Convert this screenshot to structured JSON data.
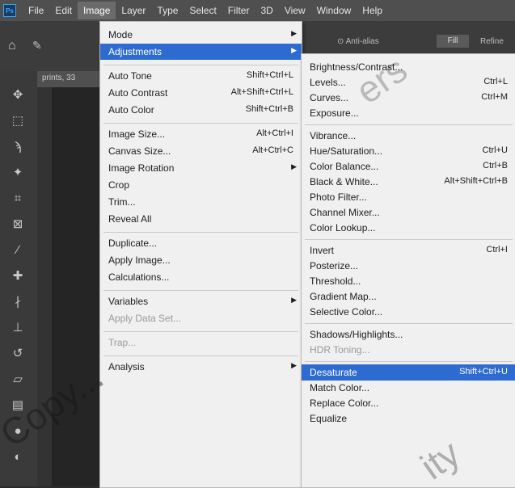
{
  "menubar": {
    "logo": "Ps",
    "items": [
      "File",
      "Edit",
      "Image",
      "Layer",
      "Type",
      "Select",
      "Filter",
      "3D",
      "View",
      "Window",
      "Help"
    ],
    "active": "Image"
  },
  "document": {
    "tab_label": "prints, 33"
  },
  "options_bar": {
    "label_left": "⊙ Anti-alias",
    "button": "Fill",
    "label_right": "Refine"
  },
  "toolbar": {
    "tools": [
      "move-icon",
      "marquee-icon",
      "lasso-icon",
      "magic-wand-icon",
      "crop-icon",
      "frame-icon",
      "eyedropper-icon",
      "healing-icon",
      "brush-icon",
      "stamp-icon",
      "history-brush-icon",
      "eraser-icon",
      "gradient-icon",
      "blur-icon",
      "dodge-icon"
    ]
  },
  "image_menu": {
    "items": [
      {
        "label": "Mode",
        "shortcut": "",
        "submenu": true
      },
      {
        "label": "Adjustments",
        "shortcut": "",
        "submenu": true,
        "highlighted": true
      },
      {
        "separator": true
      },
      {
        "label": "Auto Tone",
        "shortcut": "Shift+Ctrl+L"
      },
      {
        "label": "Auto Contrast",
        "shortcut": "Alt+Shift+Ctrl+L"
      },
      {
        "label": "Auto Color",
        "shortcut": "Shift+Ctrl+B"
      },
      {
        "separator": true
      },
      {
        "label": "Image Size...",
        "shortcut": "Alt+Ctrl+I"
      },
      {
        "label": "Canvas Size...",
        "shortcut": "Alt+Ctrl+C"
      },
      {
        "label": "Image Rotation",
        "shortcut": "",
        "submenu": true
      },
      {
        "label": "Crop",
        "shortcut": ""
      },
      {
        "label": "Trim...",
        "shortcut": ""
      },
      {
        "label": "Reveal All",
        "shortcut": ""
      },
      {
        "separator": true
      },
      {
        "label": "Duplicate...",
        "shortcut": ""
      },
      {
        "label": "Apply Image...",
        "shortcut": ""
      },
      {
        "label": "Calculations...",
        "shortcut": ""
      },
      {
        "separator": true
      },
      {
        "label": "Variables",
        "shortcut": "",
        "submenu": true
      },
      {
        "label": "Apply Data Set...",
        "shortcut": "",
        "disabled": true
      },
      {
        "separator": true
      },
      {
        "label": "Trap...",
        "shortcut": "",
        "disabled": true
      },
      {
        "separator": true
      },
      {
        "label": "Analysis",
        "shortcut": "",
        "submenu": true
      }
    ]
  },
  "adjustments_menu": {
    "items": [
      {
        "label": "Brightness/Contrast...",
        "shortcut": ""
      },
      {
        "label": "Levels...",
        "shortcut": "Ctrl+L"
      },
      {
        "label": "Curves...",
        "shortcut": "Ctrl+M"
      },
      {
        "label": "Exposure...",
        "shortcut": ""
      },
      {
        "separator": true
      },
      {
        "label": "Vibrance...",
        "shortcut": ""
      },
      {
        "label": "Hue/Saturation...",
        "shortcut": "Ctrl+U"
      },
      {
        "label": "Color Balance...",
        "shortcut": "Ctrl+B"
      },
      {
        "label": "Black & White...",
        "shortcut": "Alt+Shift+Ctrl+B"
      },
      {
        "label": "Photo Filter...",
        "shortcut": ""
      },
      {
        "label": "Channel Mixer...",
        "shortcut": ""
      },
      {
        "label": "Color Lookup...",
        "shortcut": ""
      },
      {
        "separator": true
      },
      {
        "label": "Invert",
        "shortcut": "Ctrl+I"
      },
      {
        "label": "Posterize...",
        "shortcut": ""
      },
      {
        "label": "Threshold...",
        "shortcut": ""
      },
      {
        "label": "Gradient Map...",
        "shortcut": ""
      },
      {
        "label": "Selective Color...",
        "shortcut": ""
      },
      {
        "separator": true
      },
      {
        "label": "Shadows/Highlights...",
        "shortcut": ""
      },
      {
        "label": "HDR Toning...",
        "shortcut": "",
        "disabled": true
      },
      {
        "separator": true
      },
      {
        "label": "Desaturate",
        "shortcut": "Shift+Ctrl+U",
        "highlighted": true
      },
      {
        "label": "Match Color...",
        "shortcut": ""
      },
      {
        "label": "Replace Color...",
        "shortcut": ""
      },
      {
        "label": "Equalize",
        "shortcut": ""
      }
    ]
  },
  "watermark": {
    "text_main": "Copy...",
    "text_a": "ers",
    "text_b": "ity"
  },
  "colors": {
    "highlight": "#2e6bd0",
    "menu_bg": "#f0f0f0",
    "app_bg": "#2b2b2b"
  }
}
